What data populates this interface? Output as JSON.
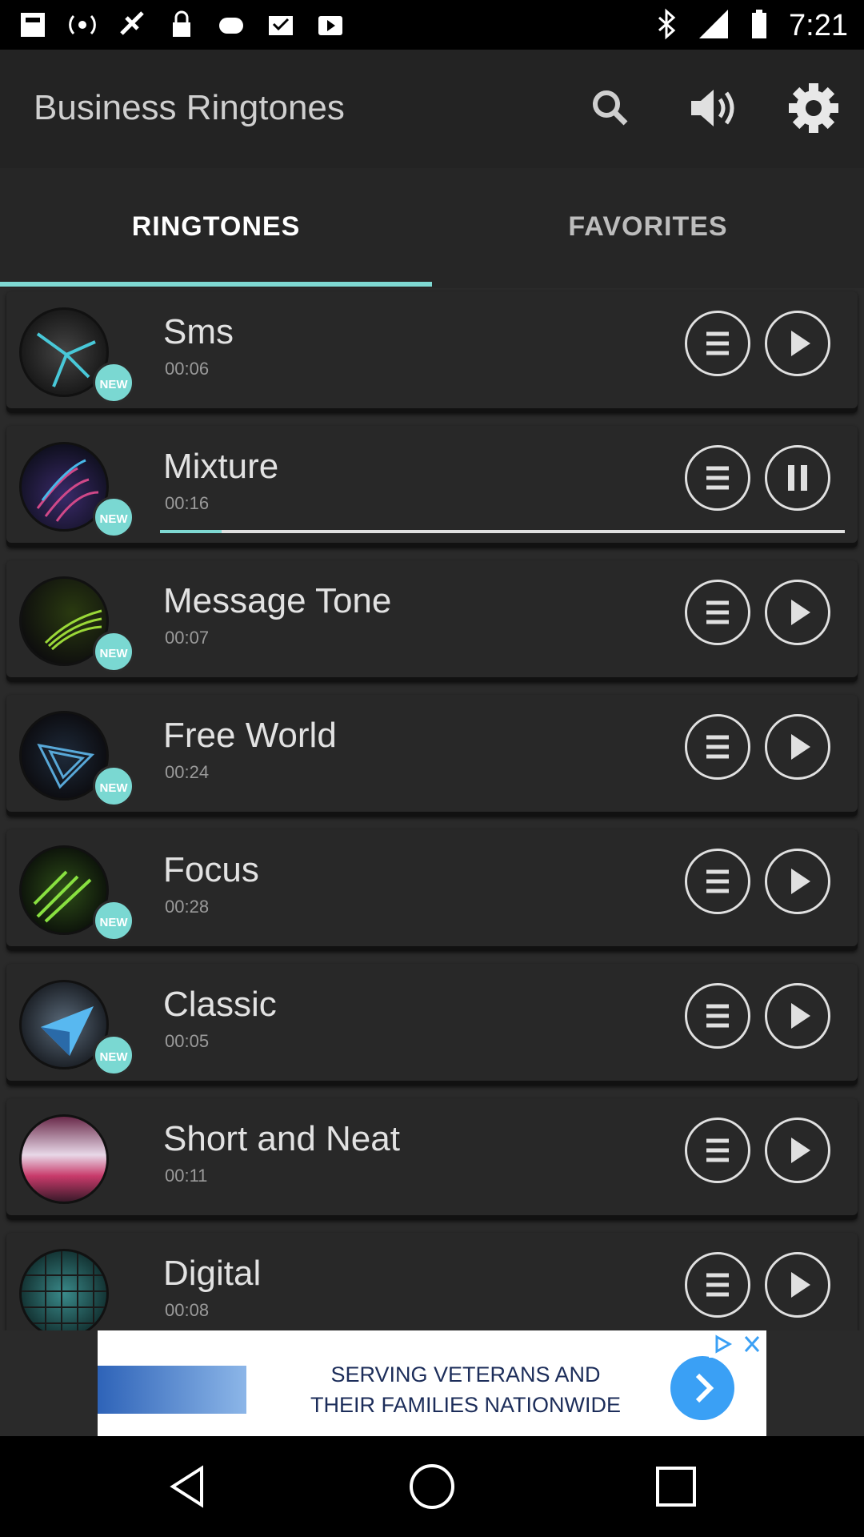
{
  "status_bar": {
    "time": "7:21"
  },
  "app_bar": {
    "title": "Business Ringtones",
    "icons": [
      "search-icon",
      "volume-icon",
      "settings-gear-icon"
    ]
  },
  "tabs": [
    {
      "label": "RINGTONES",
      "active": true
    },
    {
      "label": "FAVORITES",
      "active": false
    }
  ],
  "accent_color": "#7fd9d3",
  "items": [
    {
      "name": "Sms",
      "duration": "00:06",
      "badge": "NEW",
      "state": "play"
    },
    {
      "name": "Mixture",
      "duration": "00:16",
      "badge": "NEW",
      "state": "pause",
      "progress": 0.09
    },
    {
      "name": "Message Tone",
      "duration": "00:07",
      "badge": "NEW",
      "state": "play"
    },
    {
      "name": "Free World",
      "duration": "00:24",
      "badge": "NEW",
      "state": "play"
    },
    {
      "name": "Focus",
      "duration": "00:28",
      "badge": "NEW",
      "state": "play"
    },
    {
      "name": "Classic",
      "duration": "00:05",
      "badge": "NEW",
      "state": "play"
    },
    {
      "name": "Short and Neat",
      "duration": "00:11",
      "badge": "",
      "state": "play"
    },
    {
      "name": "Digital",
      "duration": "00:08",
      "badge": "",
      "state": "play"
    }
  ],
  "ad": {
    "line1": "SERVING VETERANS AND",
    "line2": "THEIR FAMILIES NATIONWIDE"
  }
}
